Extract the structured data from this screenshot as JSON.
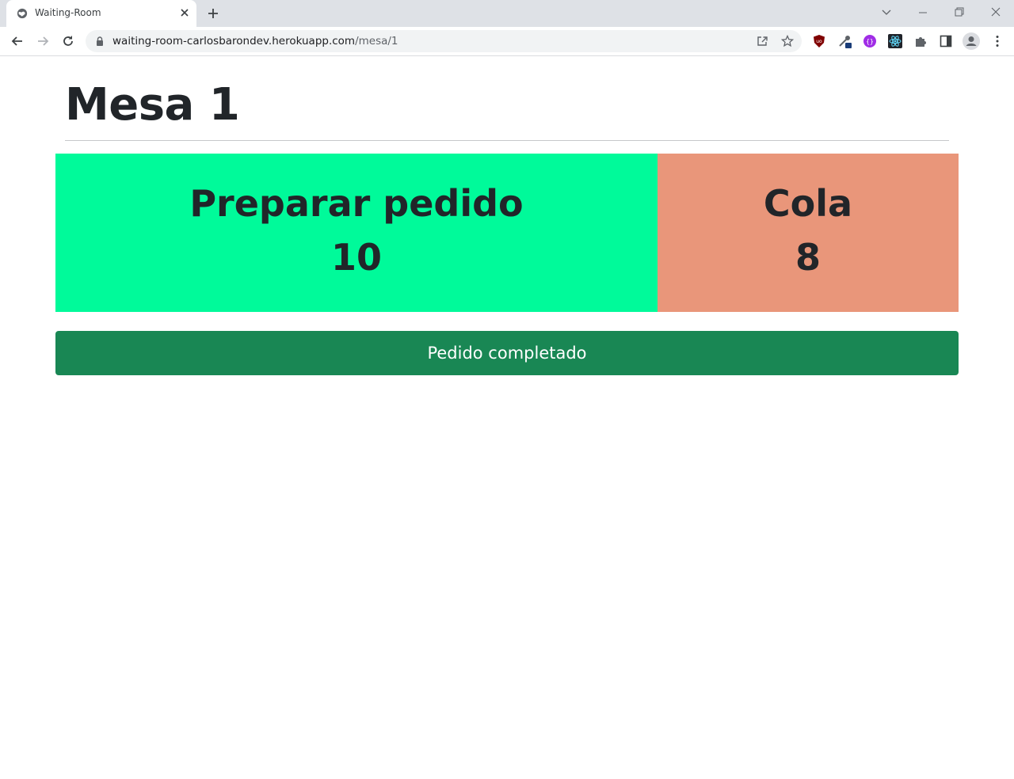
{
  "browser": {
    "tab_title": "Waiting-Room",
    "url_host": "waiting-room-carlosbarondev.herokuapp.com",
    "url_path": "/mesa/1"
  },
  "page": {
    "title": "Mesa 1",
    "main_card": {
      "label": "Preparar pedido",
      "value": "10",
      "color": "#00fa9a"
    },
    "queue_card": {
      "label": "Cola",
      "value": "8",
      "color": "#e9967a"
    },
    "complete_button_label": "Pedido completado",
    "button_color": "#198754"
  }
}
